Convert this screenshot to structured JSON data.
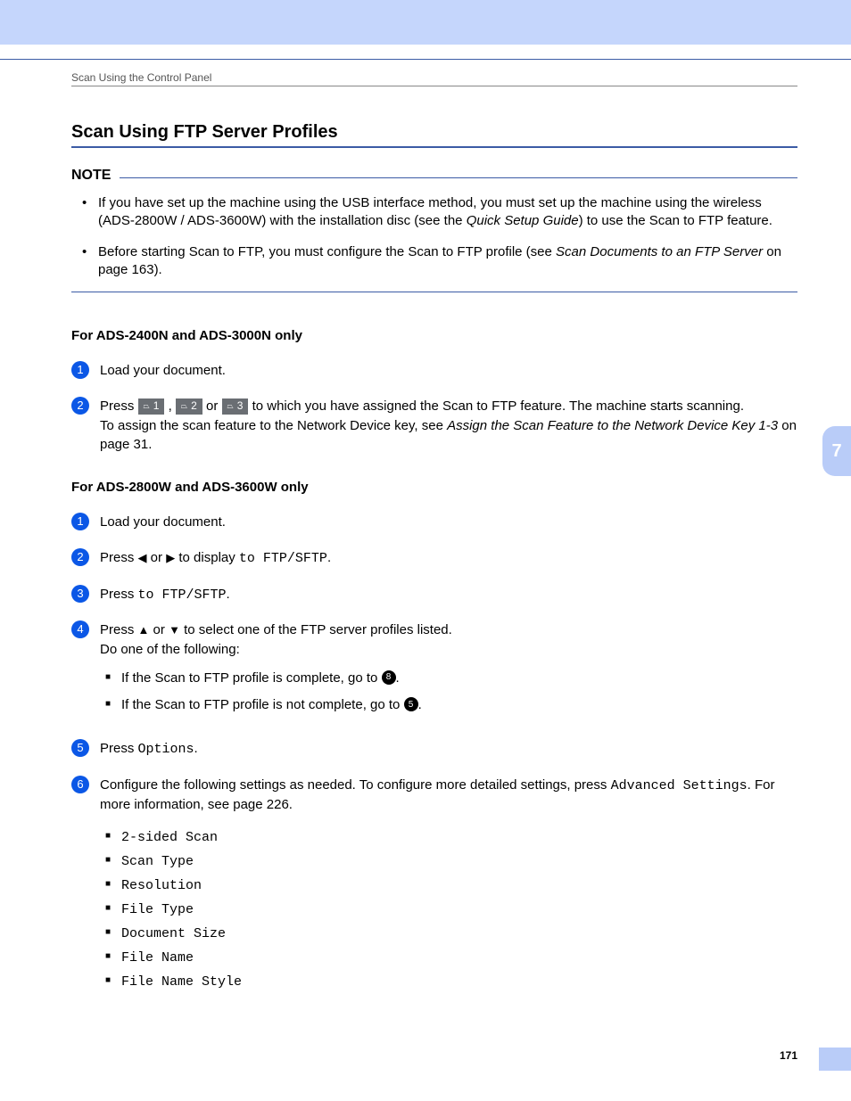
{
  "breadcrumb": "Scan Using the Control Panel",
  "title": "Scan Using FTP Server Profiles",
  "note_label": "NOTE",
  "notes": [
    {
      "pre": "If you have set up the machine using the USB interface method, you must set up the machine using the wireless (ADS-2800W / ADS-3600W) with the installation disc (see the ",
      "ital": "Quick Setup Guide",
      "post": ") to use the Scan to FTP feature."
    },
    {
      "pre": "Before starting Scan to FTP, you must configure the Scan to FTP profile (see ",
      "ital": "Scan Documents to an FTP Server",
      "post": " on page 163)."
    }
  ],
  "section_a_head": "For ADS-2400N and ADS-3000N only",
  "a_step1": "Load your document.",
  "a_step2": {
    "pre": "Press ",
    "key1": "1",
    "key2": "2",
    "key3": "3",
    "mid": " to which you have assigned the Scan to FTP feature. The machine starts scanning.",
    "line2_pre": "To assign the scan feature to the Network Device key, see ",
    "line2_ital": "Assign the Scan Feature to the Network Device Key 1-3",
    "line2_post": " on page 31."
  },
  "section_b_head": "For ADS-2800W and ADS-3600W only",
  "b_step1": "Load your document.",
  "b_step2": {
    "pre": "Press ",
    "mid": " or ",
    "post": " to display ",
    "mono": "to FTP/SFTP",
    "end": "."
  },
  "b_step3": {
    "pre": "Press ",
    "mono": "to FTP/SFTP",
    "end": "."
  },
  "b_step4": {
    "line1_pre": "Press ",
    "line1_mid": " or ",
    "line1_post": " to select one of the FTP server profiles listed.",
    "line2": "Do one of the following:",
    "bullet1_pre": "If the Scan to FTP profile is complete, go to ",
    "bullet1_ref": "8",
    "bullet1_post": ".",
    "bullet2_pre": "If the Scan to FTP profile is not complete, go to ",
    "bullet2_ref": "5",
    "bullet2_post": "."
  },
  "b_step5": {
    "pre": "Press ",
    "mono": "Options",
    "end": "."
  },
  "b_step6": {
    "pre": "Configure the following settings as needed. To configure more detailed settings, press ",
    "mono1": "Advanced Settings",
    "post": ". For more information, see page 226.",
    "settings": [
      "2-sided Scan",
      "Scan Type",
      "Resolution",
      "File Type",
      "Document Size",
      "File Name",
      "File Name Style"
    ]
  },
  "side_tab": "7",
  "page_number": "171"
}
